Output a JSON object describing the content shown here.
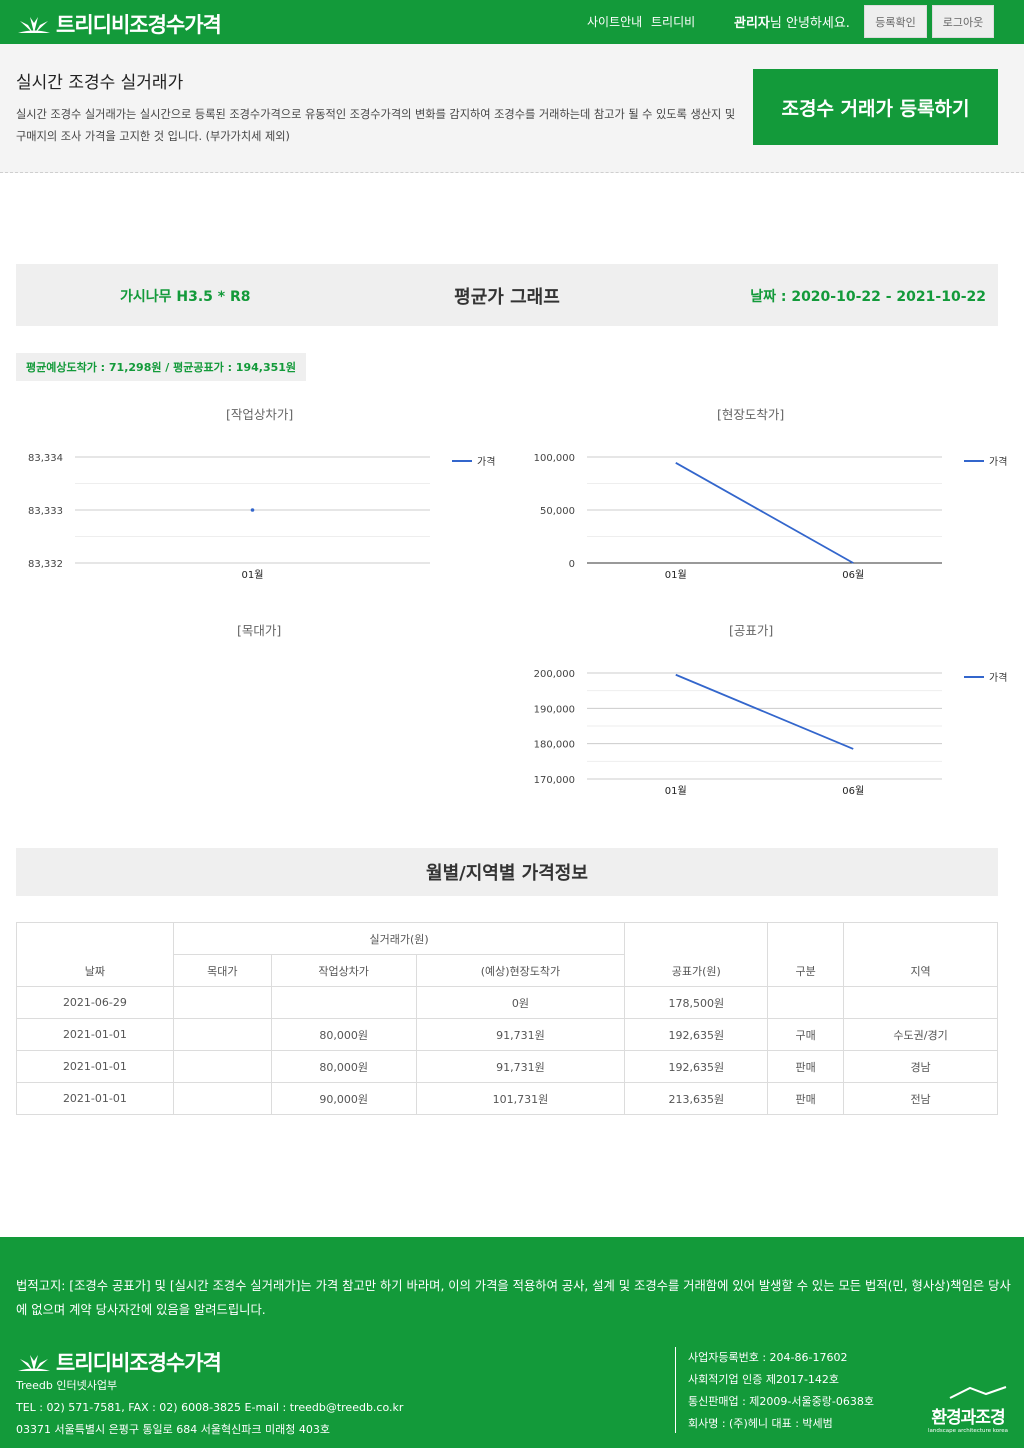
{
  "header": {
    "logo_text": "트리디비조경수가격",
    "nav": [
      "사이트안내",
      "트리디비"
    ],
    "user_name": "관리자",
    "greeting": "님 안녕하세요.",
    "btn_register_check": "등록확인",
    "btn_logout": "로그아웃"
  },
  "intro": {
    "title": "실시간 조경수 실거래가",
    "description": "실시간 조경수 실거래가는 실시간으로 등록된 조경수가격으로 유동적인 조경수가격의 변화를 감지하여 조경수를 거래하는데 참고가 될 수 있도록 생산지 및 구매지의 조사 가격을 고지한 것 입니다. (부가가치세 제외)",
    "register_button": "조경수 거래가 등록하기"
  },
  "graph_header": {
    "tree": "가시나무 H3.5 * R8",
    "title": "평균가 그래프",
    "date": "날짜 : 2020-10-22 - 2021-10-22"
  },
  "avg_badge": "평균예상도착가 : 71,298원 / 평균공표가 : 194,351원",
  "chart_data": [
    {
      "type": "line",
      "title": "[작업상차가]",
      "categories": [
        "01월"
      ],
      "series": [
        {
          "name": "가격",
          "values": [
            83333
          ]
        }
      ],
      "yticks": [
        "83,334",
        "83,333",
        "83,332"
      ],
      "ylim": [
        83332,
        83334
      ],
      "legend": "right",
      "color": "#3366cc"
    },
    {
      "type": "line",
      "title": "[현장도착가]",
      "categories": [
        "01월",
        "06월"
      ],
      "series": [
        {
          "name": "가격",
          "values": [
            94500,
            0
          ]
        }
      ],
      "yticks": [
        "100,000",
        "50,000",
        "0"
      ],
      "ylim": [
        0,
        100000
      ],
      "legend": "right",
      "color": "#3366cc"
    },
    {
      "type": "line",
      "title": "[목대가]",
      "categories": [],
      "series": [],
      "empty": true
    },
    {
      "type": "line",
      "title": "[공표가]",
      "categories": [
        "01월",
        "06월"
      ],
      "series": [
        {
          "name": "가격",
          "values": [
            199500,
            178500
          ]
        }
      ],
      "yticks": [
        "200,000",
        "190,000",
        "180,000",
        "170,000"
      ],
      "ylim": [
        170000,
        200000
      ],
      "legend": "right",
      "color": "#3366cc"
    }
  ],
  "price_section": {
    "title": "월별/지역별 가격정보",
    "headers": {
      "date": "날짜",
      "real_price": "실거래가(원)",
      "wood": "목대가",
      "loading": "작업상차가",
      "arrival": "(예상)현장도착가",
      "public": "공표가(원)",
      "type": "구분",
      "region": "지역"
    },
    "rows": [
      {
        "date": "2021-06-29",
        "wood": "",
        "loading": "",
        "arrival": "0원",
        "public": "178,500원",
        "type": "",
        "region": ""
      },
      {
        "date": "2021-01-01",
        "wood": "",
        "loading": "80,000원",
        "arrival": "91,731원",
        "public": "192,635원",
        "type": "구매",
        "region": "수도권/경기"
      },
      {
        "date": "2021-01-01",
        "wood": "",
        "loading": "80,000원",
        "arrival": "91,731원",
        "public": "192,635원",
        "type": "판매",
        "region": "경남"
      },
      {
        "date": "2021-01-01",
        "wood": "",
        "loading": "90,000원",
        "arrival": "101,731원",
        "public": "213,635원",
        "type": "판매",
        "region": "전남"
      }
    ]
  },
  "footer": {
    "legal": "법적고지: [조경수 공표가] 및 [실시간 조경수 실거래가]는 가격 참고만 하기 바라며, 이의 가격을 적용하여 공사, 설계 및 조경수를 거래함에 있어 발생할 수 있는 모든 법적(민, 형사상)책임은 당사에 없으며 계약 당사자간에 있음을 알려드립니다.",
    "logo_text": "트리디비조경수가격",
    "company_lines": [
      "Treedb 인터넷사업부",
      "TEL : 02) 571-7581, FAX : 02) 6008-3825 E-mail : treedb@treedb.co.kr",
      "03371 서울특별시 은평구 통일로 684 서울혁신파크 미래청 403호"
    ],
    "business_lines": [
      "사업자등록번호 : 204-86-17602",
      "사회적기업 인증 제2017-142호",
      "통신판매업 : 제2009-서울중랑-0638호",
      "회사명 : (주)헤니 대표 : 박세범"
    ],
    "badge_main": "환경과조경",
    "badge_sub": "landscape architecture korea"
  },
  "colors": {
    "brand_green": "#139a3a",
    "line_blue": "#3366cc"
  }
}
